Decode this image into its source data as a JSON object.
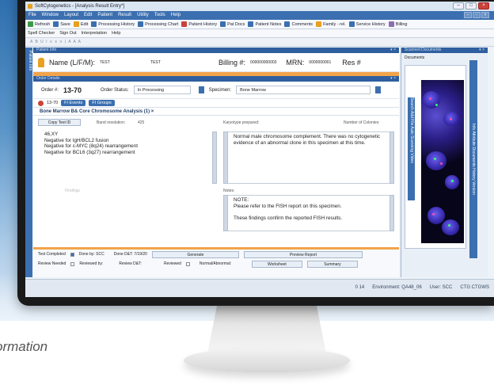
{
  "caption": "ormation",
  "app": {
    "title": "SoftCytogenetics - [Analysis Result Entry*]",
    "menu": [
      "File",
      "Window",
      "Layout",
      "Edit",
      "Patient",
      "Result",
      "Utility",
      "Tools",
      "Help"
    ],
    "toolbar": [
      "Refresh",
      "Save",
      "Edit",
      "Processing History",
      "Processing Chart",
      "Patient History",
      "Pat Docs",
      "Patient Notes",
      "Comments",
      "Family - rel.",
      "Service History",
      "Billing"
    ],
    "toolbar2": [
      "Spell Checker",
      "Sign Out",
      "Interpretation",
      "Help"
    ],
    "fmt": "A  B  U  I  ≡  ≡  ≡  |  A  A  A"
  },
  "left_strip": "Patient Info",
  "patient": {
    "panel_label": "Patient Info",
    "name_label": "Name (L/F/M):",
    "last": "TEST",
    "first": "TEST",
    "billing_label": "Billing #:",
    "billing_value": "000000000003",
    "mrn_label": "MRN:",
    "mrn_value": "0000000001",
    "res_label": "Res #"
  },
  "order": {
    "panel_label": "Order Details",
    "order_label": "Order #:",
    "order_value": "13-70",
    "status_label": "Order Status:",
    "status_value": "In Processing",
    "specimen_label": "Specimen:",
    "specimen_value": "Bone Marrow"
  },
  "tabs": [
    "13-70",
    "FI Events",
    "FI Groups"
  ],
  "analysis": {
    "title": "Bone Marrow B& Core Chromosome Analysis (1)",
    "copy_button": "Copy Test ID",
    "band_label": "Band resolution:",
    "band_value": "425",
    "karyotype_label": "Karyotype prepared:",
    "colonies_label": "Number of Colonies:",
    "results": [
      "46,XY",
      "Negative for IgH/BCL2 fusion",
      "Negative for c-MYC (8q24) rearrangement",
      "Negative for BCL6 (3q27) rearrangement"
    ],
    "interpretation": "Normal male chromosome complement. There was no cytogenetic evidence of an abnormal clone in this specimen at this time.",
    "findings_label": "Findings",
    "notes_label": "Notes:",
    "notes_lines": [
      "NOTE:",
      "Please refer to the FISH report on this specimen.",
      "",
      "These findings confirm the reported FISH results."
    ]
  },
  "bottom": {
    "test_completed": "Test Completed",
    "done_by": "Done by: SCC",
    "done_dt": "Done D&T: 7/19/20",
    "generate": "Generate",
    "preview": "Preview Report",
    "review_needed": "Review Needed",
    "reviewed_by": "Reviewed by:",
    "review_dt": "Review D&T:",
    "reviewed": "Reviewed",
    "normal_abnormal": "Normal/Abnormal:",
    "worksheet": "Worksheet",
    "summary": "Summary"
  },
  "right": {
    "panel_label": "Scanned Documents",
    "tab": "Documents",
    "vtabs": "Info  Attribute  Documents  History  Version",
    "lefttabs": "Search  Add File  Auto Scanning  Video"
  },
  "status": {
    "counts": "0    14",
    "env": "Environment: QA48_06",
    "user": "User: SCC",
    "site": "CTG  CTGWS"
  },
  "colors": {
    "accent": "#3b6fb0",
    "orange": "#f2a44a"
  }
}
